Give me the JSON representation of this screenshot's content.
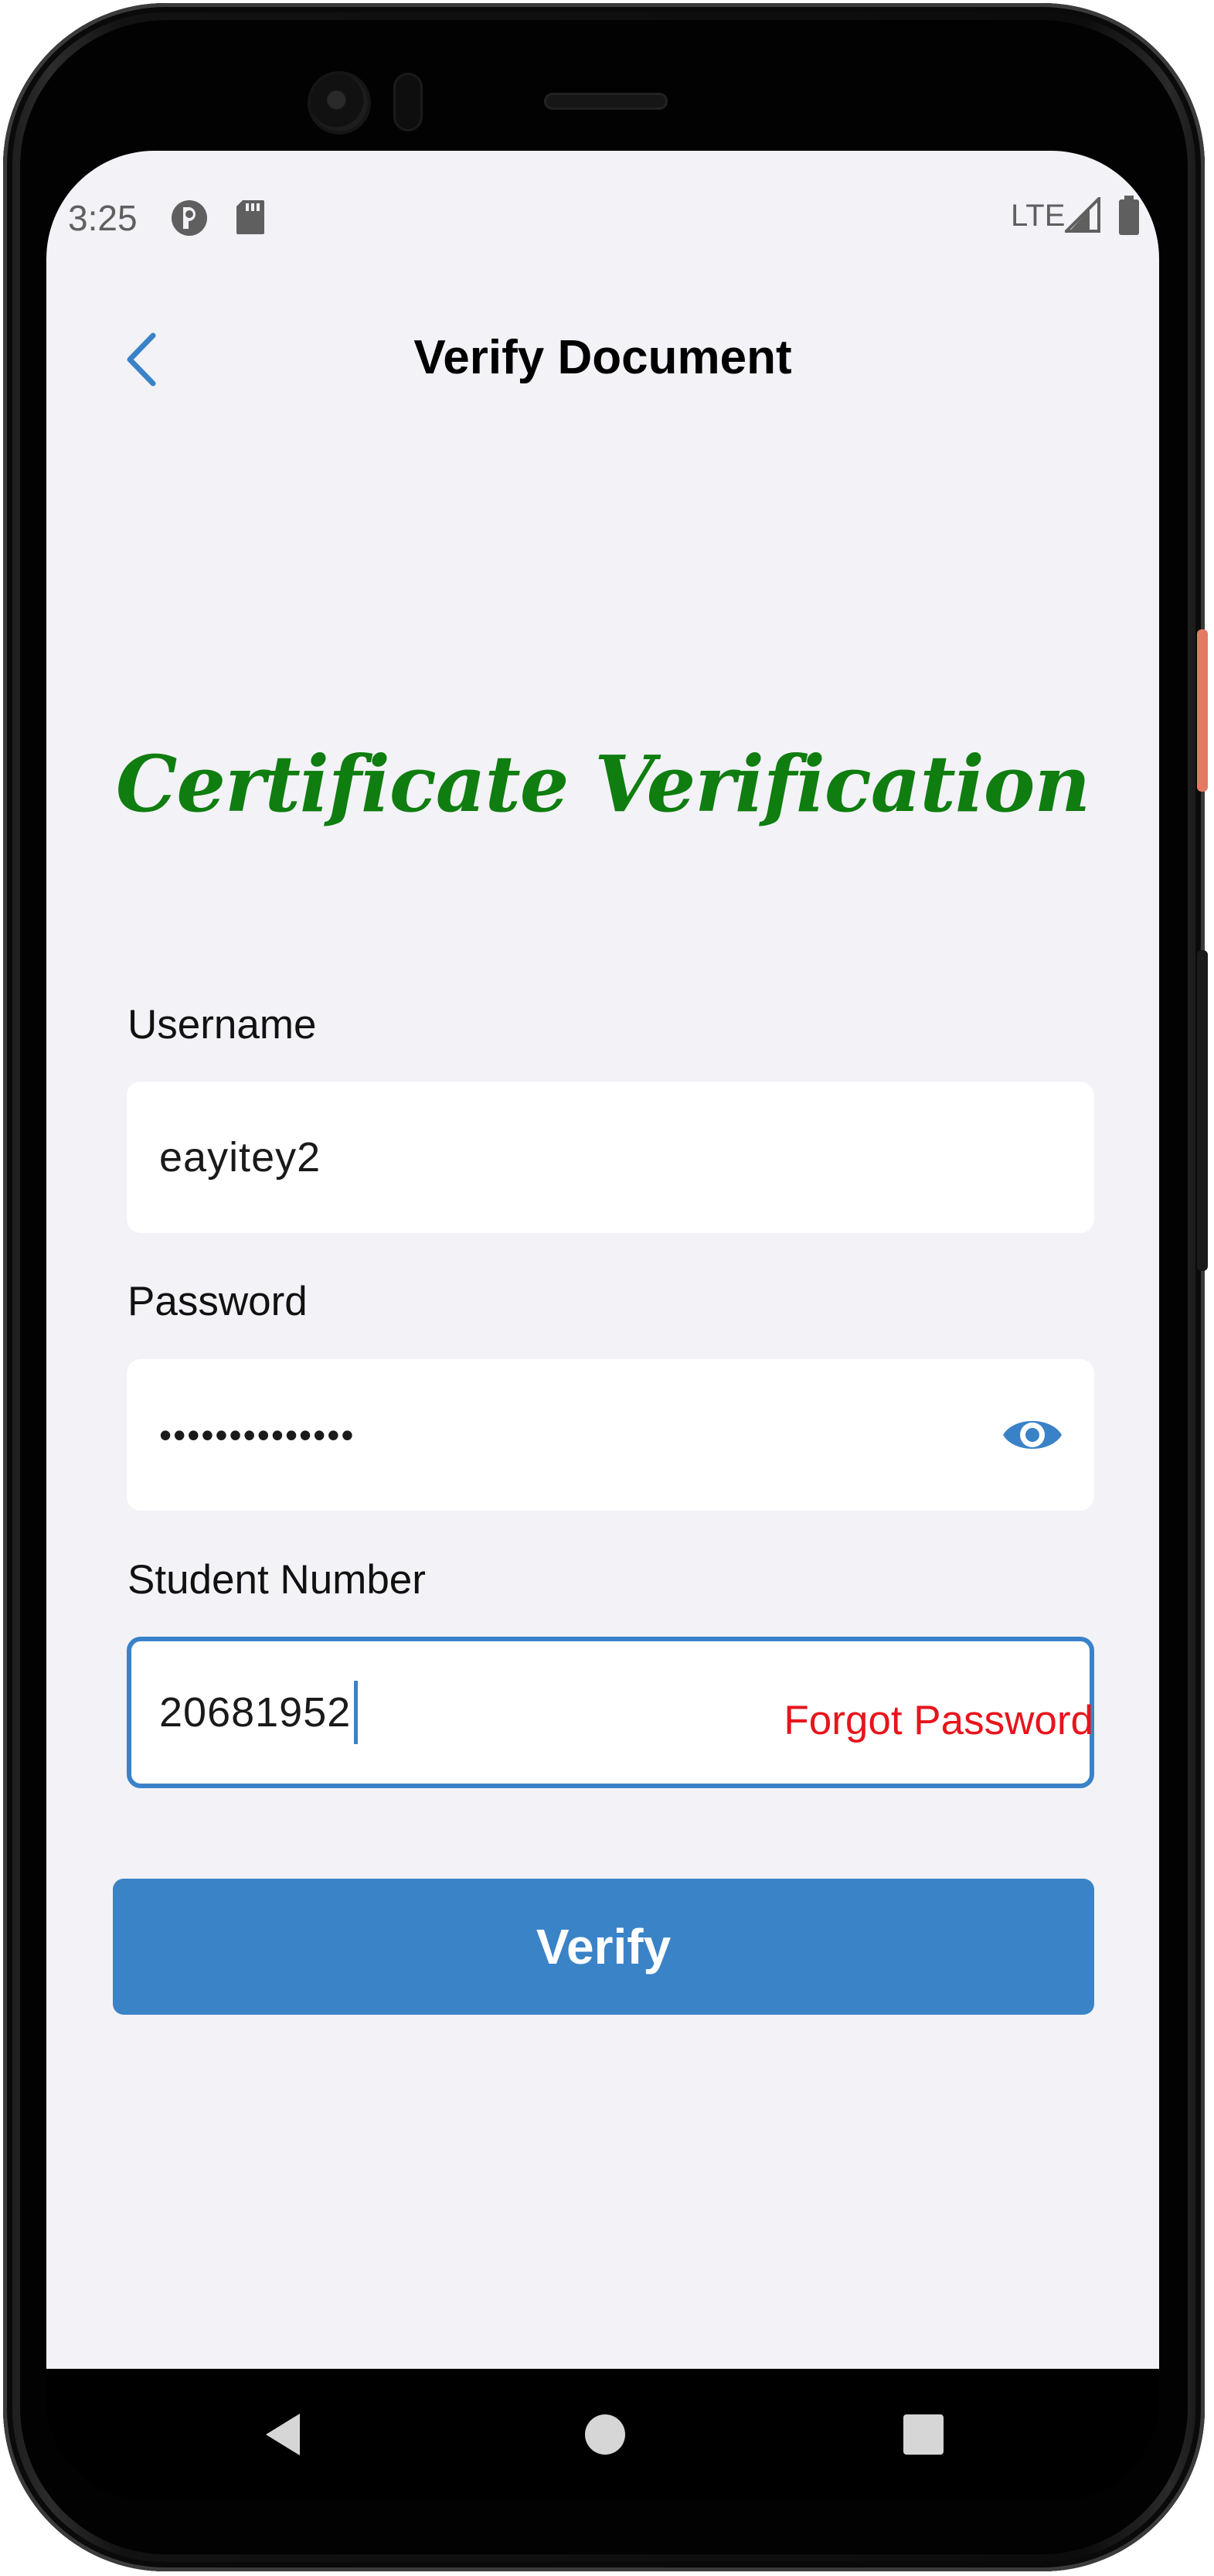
{
  "status_bar": {
    "time": "3:25",
    "network": "LTE",
    "icons": [
      "app-notification-icon",
      "sd-card-icon",
      "signal-icon",
      "battery-icon"
    ]
  },
  "header": {
    "title": "Verify Document",
    "back_icon": "chevron-left-icon"
  },
  "heading": "Certificate Verification",
  "form": {
    "username": {
      "label": "Username",
      "value": "eayitey2"
    },
    "password": {
      "label": "Password",
      "value": "••••••••••••••",
      "toggle_icon": "eye-icon"
    },
    "student_number": {
      "label": "Student Number",
      "value": "20681952"
    }
  },
  "forgot_password": "Forgot Password",
  "verify_button": "Verify",
  "nav_bar": {
    "icons": [
      "back-triangle-icon",
      "home-circle-icon",
      "recents-square-icon"
    ]
  },
  "colors": {
    "accent": "#3b83c7",
    "heading_green": "#0f7d0f",
    "link_red": "#e8141c",
    "background": "#f2f2f7"
  }
}
